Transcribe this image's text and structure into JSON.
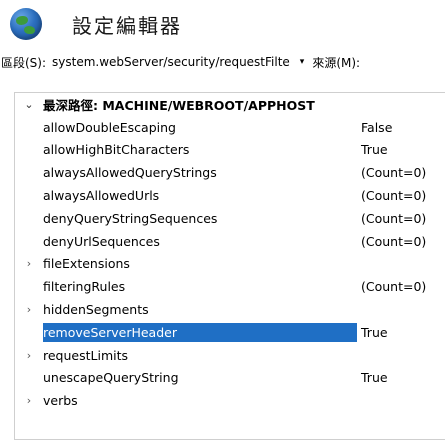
{
  "app": {
    "title": "設定編輯器",
    "icon": "globe-icon"
  },
  "section_bar": {
    "section_label": "區段(S):",
    "section_value": "system.webServer/security/requestFilte",
    "dropdown_icon": "▾",
    "source_label": "來源(M):"
  },
  "grid": {
    "group_title": "最深路徑: MACHINE/WEBROOT/APPHOST",
    "group_expander": "⌄",
    "collapsed_expander": "›",
    "selected_color": "#1f6fc5",
    "rows": [
      {
        "name": "allowDoubleEscaping",
        "value": "False",
        "expandable": false,
        "selected": false
      },
      {
        "name": "allowHighBitCharacters",
        "value": "True",
        "expandable": false,
        "selected": false
      },
      {
        "name": "alwaysAllowedQueryStrings",
        "value": "(Count=0)",
        "expandable": false,
        "selected": false
      },
      {
        "name": "alwaysAllowedUrls",
        "value": "(Count=0)",
        "expandable": false,
        "selected": false
      },
      {
        "name": "denyQueryStringSequences",
        "value": "(Count=0)",
        "expandable": false,
        "selected": false
      },
      {
        "name": "denyUrlSequences",
        "value": "(Count=0)",
        "expandable": false,
        "selected": false
      },
      {
        "name": "fileExtensions",
        "value": "",
        "expandable": true,
        "selected": false
      },
      {
        "name": "filteringRules",
        "value": "(Count=0)",
        "expandable": false,
        "selected": false
      },
      {
        "name": "hiddenSegments",
        "value": "",
        "expandable": true,
        "selected": false
      },
      {
        "name": "removeServerHeader",
        "value": "True",
        "expandable": false,
        "selected": true
      },
      {
        "name": "requestLimits",
        "value": "",
        "expandable": true,
        "selected": false
      },
      {
        "name": "unescapeQueryString",
        "value": "True",
        "expandable": false,
        "selected": false
      },
      {
        "name": "verbs",
        "value": "",
        "expandable": true,
        "selected": false
      }
    ]
  }
}
